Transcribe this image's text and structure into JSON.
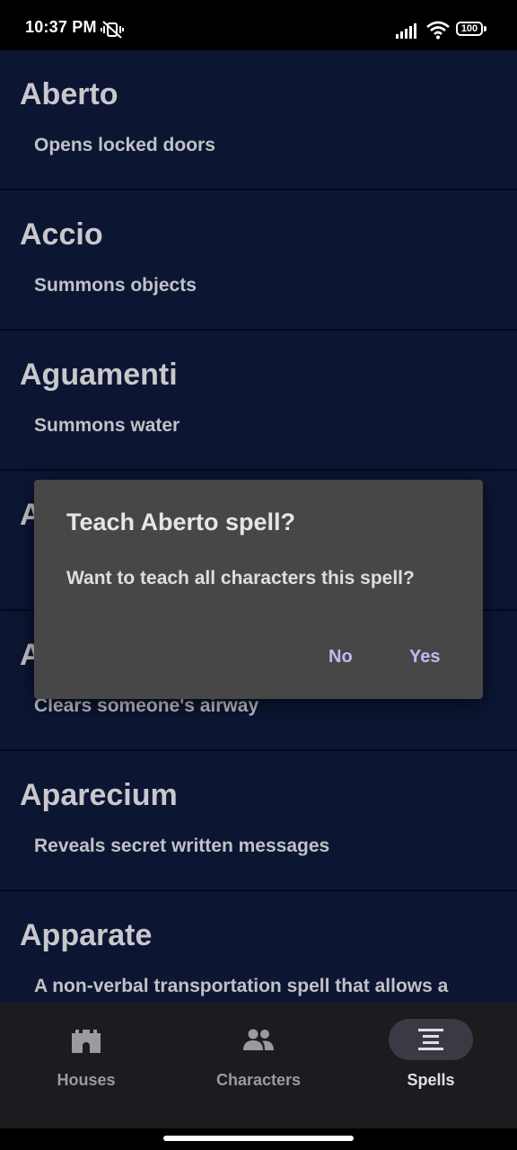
{
  "status_bar": {
    "time": "10:37 PM",
    "battery": "100"
  },
  "spells": [
    {
      "name": "Aberto",
      "description": "Opens locked doors"
    },
    {
      "name": "Accio",
      "description": "Summons objects"
    },
    {
      "name": "Aguamenti",
      "description": "Summons water"
    },
    {
      "name": "A",
      "description": ""
    },
    {
      "name": "A",
      "description": "Clears someone's airway"
    },
    {
      "name": "Aparecium",
      "description": "Reveals secret written messages"
    },
    {
      "name": "Apparate",
      "description": "A non-verbal transportation spell that allows a"
    }
  ],
  "dialog": {
    "title": "Teach Aberto spell?",
    "message": "Want to teach all characters this spell?",
    "no_label": "No",
    "yes_label": "Yes"
  },
  "bottom_nav": {
    "items": [
      {
        "label": "Houses",
        "icon": "castle-icon"
      },
      {
        "label": "Characters",
        "icon": "people-icon"
      },
      {
        "label": "Spells",
        "icon": "spells-list-icon",
        "selected": true
      }
    ]
  },
  "colors": {
    "list_background": "#0c1633",
    "dialog_background": "#474747",
    "dialog_button": "#c8b6ef",
    "nav_background": "#1c1b1f",
    "nav_active_indicator": "#3a3a44"
  }
}
